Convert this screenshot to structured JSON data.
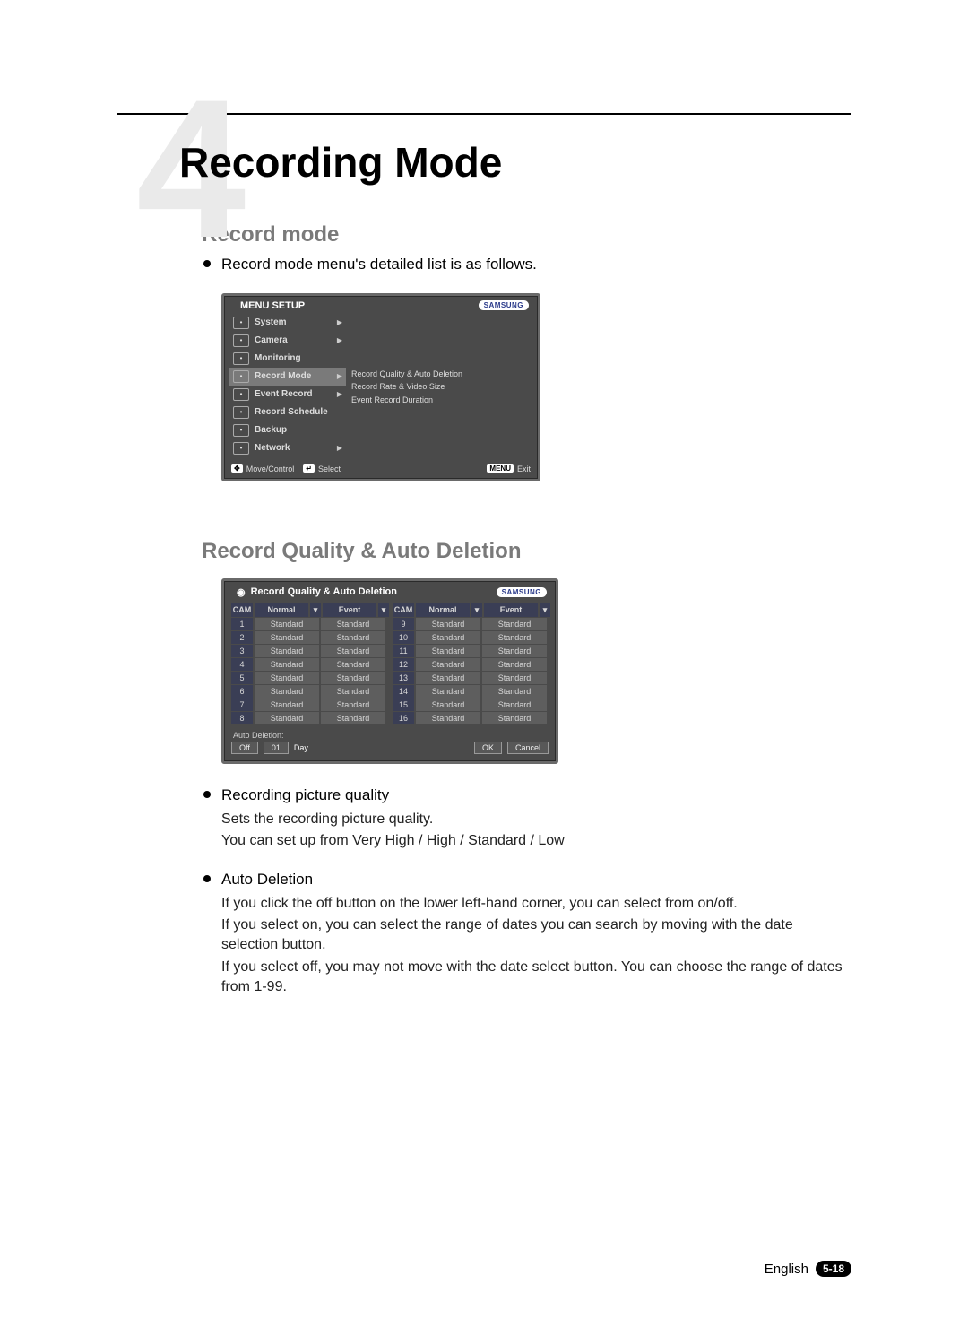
{
  "chapter": {
    "number": "4",
    "title": "Recording Mode"
  },
  "sections": {
    "record_mode": {
      "title": "Record mode",
      "intro": "Record mode menu's detailed list is as follows."
    },
    "record_quality": {
      "title": "Record Quality & Auto Deletion",
      "b1_title": "Recording picture quality",
      "b1_l1": "Sets the recording picture quality.",
      "b1_l2": "You can set up from Very High / High / Standard / Low",
      "b2_title": "Auto Deletion",
      "b2_l1": "If you click the off button on the lower left-hand corner, you can select from on/off.",
      "b2_l2": "If you select on, you can select the range of dates you can search by moving with the date selection button.",
      "b2_l3": "If you select off, you may not move with the date select button. You can choose the range of dates from 1-99."
    }
  },
  "osd1": {
    "header": "MENU SETUP",
    "brand": "SAMSUNG",
    "menu": [
      {
        "label": "System",
        "arrow": true
      },
      {
        "label": "Camera",
        "arrow": true
      },
      {
        "label": "Monitoring",
        "arrow": false
      },
      {
        "label": "Record Mode",
        "arrow": true,
        "active": true
      },
      {
        "label": "Event Record",
        "arrow": true
      },
      {
        "label": "Record Schedule",
        "arrow": false
      },
      {
        "label": "Backup",
        "arrow": false
      },
      {
        "label": "Network",
        "arrow": true
      }
    ],
    "sub": [
      "Record Quality & Auto Deletion",
      "Record Rate & Video Size",
      "Event Record Duration"
    ],
    "footer": {
      "move": "Move/Control",
      "select": "Select",
      "menu_key": "MENU",
      "exit": "Exit"
    }
  },
  "osd2": {
    "title": "Record Quality & Auto Deletion",
    "brand": "SAMSUNG",
    "headers": {
      "cam": "CAM",
      "normal": "Normal",
      "event": "Event",
      "arrow": "▾"
    },
    "left_rows": [
      {
        "cam": "1",
        "normal": "Standard",
        "event": "Standard"
      },
      {
        "cam": "2",
        "normal": "Standard",
        "event": "Standard"
      },
      {
        "cam": "3",
        "normal": "Standard",
        "event": "Standard"
      },
      {
        "cam": "4",
        "normal": "Standard",
        "event": "Standard"
      },
      {
        "cam": "5",
        "normal": "Standard",
        "event": "Standard"
      },
      {
        "cam": "6",
        "normal": "Standard",
        "event": "Standard"
      },
      {
        "cam": "7",
        "normal": "Standard",
        "event": "Standard"
      },
      {
        "cam": "8",
        "normal": "Standard",
        "event": "Standard"
      }
    ],
    "right_rows": [
      {
        "cam": "9",
        "normal": "Standard",
        "event": "Standard"
      },
      {
        "cam": "10",
        "normal": "Standard",
        "event": "Standard"
      },
      {
        "cam": "11",
        "normal": "Standard",
        "event": "Standard"
      },
      {
        "cam": "12",
        "normal": "Standard",
        "event": "Standard"
      },
      {
        "cam": "13",
        "normal": "Standard",
        "event": "Standard"
      },
      {
        "cam": "14",
        "normal": "Standard",
        "event": "Standard"
      },
      {
        "cam": "15",
        "normal": "Standard",
        "event": "Standard"
      },
      {
        "cam": "16",
        "normal": "Standard",
        "event": "Standard"
      }
    ],
    "auto_label": "Auto Deletion:",
    "auto_off": "Off",
    "auto_val": "01",
    "auto_unit": "Day",
    "ok": "OK",
    "cancel": "Cancel"
  },
  "footer": {
    "lang": "English",
    "page": "5-18"
  }
}
